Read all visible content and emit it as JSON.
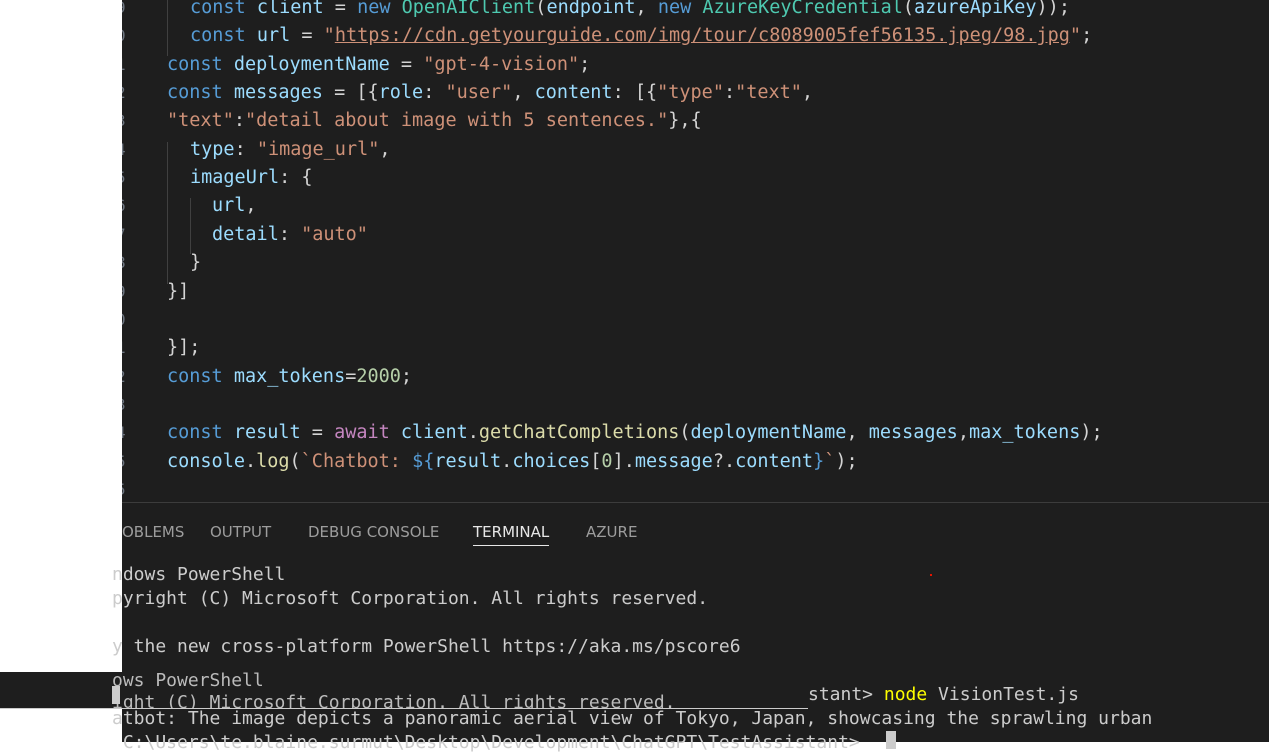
{
  "editor": {
    "lines": [
      {
        "num": "9",
        "segments": [
          [
            "kw",
            "const "
          ],
          [
            "var",
            "client"
          ],
          [
            "plain",
            " = "
          ],
          [
            "kw",
            "new "
          ],
          [
            "cls",
            "OpenAIClient"
          ],
          [
            "plain",
            "("
          ],
          [
            "var",
            "endpoint"
          ],
          [
            "plain",
            ", "
          ],
          [
            "kw",
            "new "
          ],
          [
            "cls",
            "AzureKeyCredential"
          ],
          [
            "plain",
            "("
          ],
          [
            "var",
            "azureApiKey"
          ],
          [
            "plain",
            "));"
          ]
        ]
      },
      {
        "num": "0",
        "segments": [
          [
            "kw",
            "const "
          ],
          [
            "var",
            "url"
          ],
          [
            "plain",
            " = "
          ],
          [
            "str",
            "\""
          ],
          [
            "url",
            "https://cdn.getyourguide.com/img/tour/c8089005fef56135.jpeg/98.jpg"
          ],
          [
            "str",
            "\""
          ],
          [
            "plain",
            ";"
          ]
        ]
      },
      {
        "num": "1",
        "segments": [
          [
            "kw",
            "const "
          ],
          [
            "var",
            "deploymentName"
          ],
          [
            "plain",
            " = "
          ],
          [
            "str",
            "\"gpt-4-vision\""
          ],
          [
            "plain",
            ";"
          ]
        ]
      },
      {
        "num": "2",
        "segments": [
          [
            "kw",
            "const "
          ],
          [
            "var",
            "messages"
          ],
          [
            "plain",
            " = [{"
          ],
          [
            "var",
            "role"
          ],
          [
            "plain",
            ": "
          ],
          [
            "str",
            "\"user\""
          ],
          [
            "plain",
            ", "
          ],
          [
            "var",
            "content"
          ],
          [
            "plain",
            ": [{"
          ],
          [
            "str",
            "\"type\""
          ],
          [
            "plain",
            ":"
          ],
          [
            "str",
            "\"text\""
          ],
          [
            "plain",
            ","
          ]
        ]
      },
      {
        "num": "3",
        "segments": [
          [
            "str",
            "\"text\""
          ],
          [
            "plain",
            ":"
          ],
          [
            "str",
            "\"detail about image with 5 sentences.\""
          ],
          [
            "plain",
            "},{"
          ]
        ]
      },
      {
        "num": "4",
        "segments": [
          [
            "var",
            "type"
          ],
          [
            "plain",
            ": "
          ],
          [
            "str",
            "\"image_url\""
          ],
          [
            "plain",
            ","
          ]
        ]
      },
      {
        "num": "5",
        "segments": [
          [
            "var",
            "imageUrl"
          ],
          [
            "plain",
            ": {"
          ]
        ]
      },
      {
        "num": "6",
        "segments": [
          [
            "var",
            "url"
          ],
          [
            "plain",
            ","
          ]
        ]
      },
      {
        "num": "7",
        "segments": [
          [
            "var",
            "detail"
          ],
          [
            "plain",
            ": "
          ],
          [
            "str",
            "\"auto\""
          ]
        ]
      },
      {
        "num": "8",
        "segments": [
          [
            "plain",
            "}"
          ]
        ]
      },
      {
        "num": "9",
        "segments": [
          [
            "plain",
            "}]"
          ]
        ]
      },
      {
        "num": "0",
        "segments": []
      },
      {
        "num": "1",
        "segments": [
          [
            "plain",
            "}];"
          ]
        ]
      },
      {
        "num": "2",
        "segments": [
          [
            "kw",
            "const "
          ],
          [
            "var",
            "max_tokens"
          ],
          [
            "plain",
            "="
          ],
          [
            "num",
            "2000"
          ],
          [
            "plain",
            ";"
          ]
        ]
      },
      {
        "num": "3",
        "segments": []
      },
      {
        "num": "4",
        "segments": [
          [
            "kw",
            "const "
          ],
          [
            "var",
            "result"
          ],
          [
            "plain",
            " = "
          ],
          [
            "ctl",
            "await "
          ],
          [
            "var",
            "client"
          ],
          [
            "plain",
            "."
          ],
          [
            "fn",
            "getChatCompletions"
          ],
          [
            "plain",
            "("
          ],
          [
            "var",
            "deploymentName"
          ],
          [
            "plain",
            ", "
          ],
          [
            "var",
            "messages"
          ],
          [
            "plain",
            ","
          ],
          [
            "var",
            "max_tokens"
          ],
          [
            "plain",
            ");"
          ]
        ]
      },
      {
        "num": "5",
        "segments": [
          [
            "var",
            "console"
          ],
          [
            "plain",
            "."
          ],
          [
            "fn",
            "log"
          ],
          [
            "plain",
            "("
          ],
          [
            "str",
            "`Chatbot: "
          ],
          [
            "tpl",
            "${"
          ],
          [
            "var",
            "result"
          ],
          [
            "plain",
            "."
          ],
          [
            "var",
            "choices"
          ],
          [
            "plain",
            "["
          ],
          [
            "num",
            "0"
          ],
          [
            "plain",
            "]."
          ],
          [
            "var",
            "message"
          ],
          [
            "plain",
            "?."
          ],
          [
            "var",
            "content"
          ],
          [
            "tpl",
            "}"
          ],
          [
            "str",
            "`"
          ],
          [
            "plain",
            ");"
          ]
        ]
      },
      {
        "num": "5",
        "segments": []
      }
    ]
  },
  "panel": {
    "tabs": [
      {
        "label": "OBLEMS",
        "active": false
      },
      {
        "label": "OUTPUT",
        "active": false
      },
      {
        "label": "DEBUG CONSOLE",
        "active": false
      },
      {
        "label": "TERMINAL",
        "active": true
      },
      {
        "label": "AZURE",
        "active": false
      }
    ]
  },
  "terminal": {
    "line1": "ndows PowerShell",
    "line2": "pyright (C) Microsoft Corporation. All rights reserved.",
    "line3": "y the new cross-platform PowerShell https://aka.ms/pscore6",
    "overlay_line1": "ows PowerShell",
    "overlay_line2": "ight (C) Microsoft Corporation. All rights reserved.",
    "prompt_tail": "stant> ",
    "node_cmd": "node",
    "cmd_args": " VisionTest.js",
    "chatbot_line": "atbot: The image depicts a panoramic aerial view of Tokyo, Japan, showcasing the sprawling urban",
    "last_prompt": " C:\\Users\\te.blaine.surmut\\Desktop\\Development\\ChatGPT\\TestAssistant> "
  }
}
